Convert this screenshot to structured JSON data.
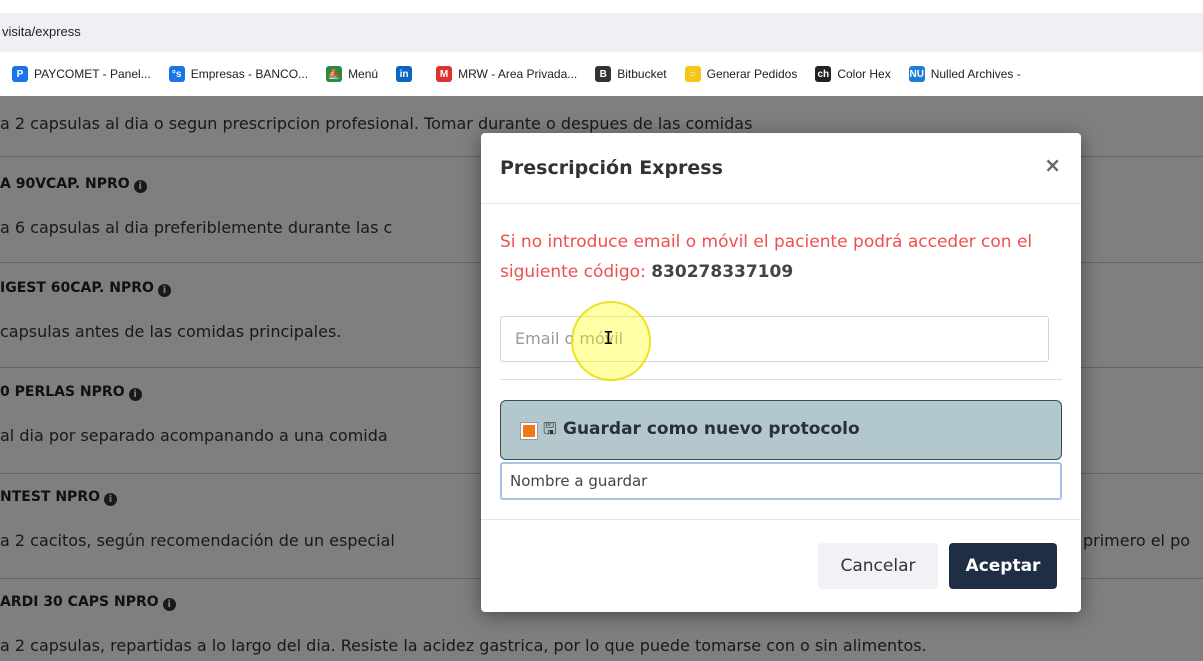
{
  "browser": {
    "address": "visita/express",
    "bookmarks": [
      {
        "label": "PAYCOMET - Panel...",
        "icon": "paycomet-icon",
        "color": "#1a73e8",
        "glyph": "P"
      },
      {
        "label": "Empresas - BANCO...",
        "icon": "banco-icon",
        "color": "#1a73e8",
        "glyph": "°s"
      },
      {
        "label": "Menú",
        "icon": "menu-ship-icon",
        "color": "#2b8a3e",
        "glyph": "⛵"
      },
      {
        "label": "",
        "icon": "linkedin-icon",
        "color": "#0a66c2",
        "glyph": "in"
      },
      {
        "label": "MRW - Area Privada...",
        "icon": "mrw-icon",
        "color": "#e03131",
        "glyph": "M"
      },
      {
        "label": "Bitbucket",
        "icon": "bitbucket-icon",
        "color": "#333333",
        "glyph": "B"
      },
      {
        "label": "Generar Pedidos",
        "icon": "generar-pedidos-icon",
        "color": "#f5c518",
        "glyph": "○"
      },
      {
        "label": "Color Hex",
        "icon": "colorhex-icon",
        "color": "#222222",
        "glyph": "ch"
      },
      {
        "label": "Nulled Archives -",
        "icon": "nulled-icon",
        "color": "#1c7ed6",
        "glyph": "NU"
      }
    ]
  },
  "page": {
    "rows": [
      {
        "type": "text",
        "text": "a 2 capsulas al dia o segun prescripcion profesional. Tomar durante o despues de las comidas"
      },
      {
        "type": "head",
        "text": "A 90VCAP. NPRO"
      },
      {
        "type": "text",
        "text": "a 6 capsulas al dia preferiblemente durante las c"
      },
      {
        "type": "head",
        "text": "IGEST 60CAP. NPRO"
      },
      {
        "type": "text",
        "text": "capsulas antes de las comidas principales."
      },
      {
        "type": "head",
        "text": "0 PERLAS NPRO"
      },
      {
        "type": "text",
        "text": "al dia por separado acompanando a una comida"
      },
      {
        "type": "head",
        "text": "NTEST NPRO"
      },
      {
        "type": "text",
        "text": "a 2 cacitos, según recomendación de un especial",
        "tail": "primero el po"
      },
      {
        "type": "head",
        "text": "ARDI 30 CAPS NPRO"
      },
      {
        "type": "text",
        "text": "a 2 capsulas, repartidas a lo largo del dia. Resiste la acidez gastrica, por lo que puede tomarse con o sin alimentos."
      }
    ]
  },
  "modal": {
    "title": "Prescripción Express",
    "close_glyph": "×",
    "warning_text": "Si no introduce email o móvil el paciente podrá acceder con el siguiente código:",
    "code": "830278337109",
    "contact_placeholder": "Email o móvil",
    "save_protocol_label": "Guardar como nuevo protocolo",
    "name_placeholder": "Nombre a guardar",
    "cancel_label": "Cancelar",
    "accept_label": "Aceptar"
  },
  "colors": {
    "warning": "#f04e4e",
    "accept_bg": "#1f2d45",
    "protocol_bg": "#b3c8cc",
    "checkbox": "#f07a1a"
  }
}
